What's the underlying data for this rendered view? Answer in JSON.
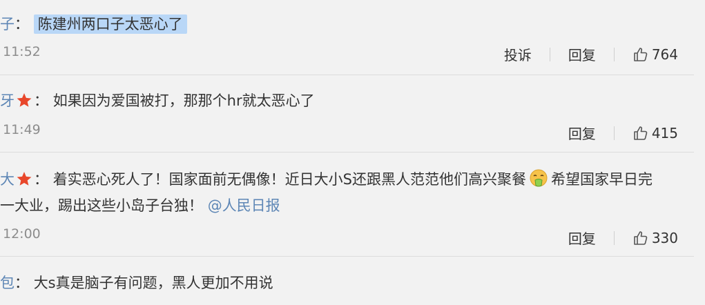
{
  "comments": [
    {
      "user": "子",
      "separator": "：",
      "text": "陈建州两口子太恶心了",
      "time": "11:52",
      "actions": {
        "report": "投诉",
        "reply": "回复"
      },
      "likes": "764"
    },
    {
      "user": "牙",
      "separator": "：",
      "text": "如果因为爱国被打，那那个hr就太恶心了",
      "time": "11:49",
      "actions": {
        "reply": "回复"
      },
      "likes": "415"
    },
    {
      "user": "大",
      "separator": "：",
      "text_part1": "着实恶心死人了！国家面前无偶像！近日大小S还跟黑人范范他们高兴聚餐",
      "text_part2": "希望国家早日完",
      "text_line2": "一大业，踢出这些小岛子台独！",
      "mention": "@人民日报",
      "time": "12:00",
      "actions": {
        "reply": "回复"
      },
      "likes": "330"
    },
    {
      "user": "包",
      "separator": "：",
      "text": "大s真是脑子有问题，黑人更加不用说"
    }
  ],
  "icons": {
    "like": "thumbs-up-icon",
    "badge": "red-star-icon",
    "emoji": "vomiting-face-emoji"
  },
  "colors": {
    "background": "#f2f2f2",
    "username": "#5d86b5",
    "text": "#333333",
    "time": "#8c8c8c",
    "highlight": "#b9d7f7",
    "star": "#e8472b"
  }
}
